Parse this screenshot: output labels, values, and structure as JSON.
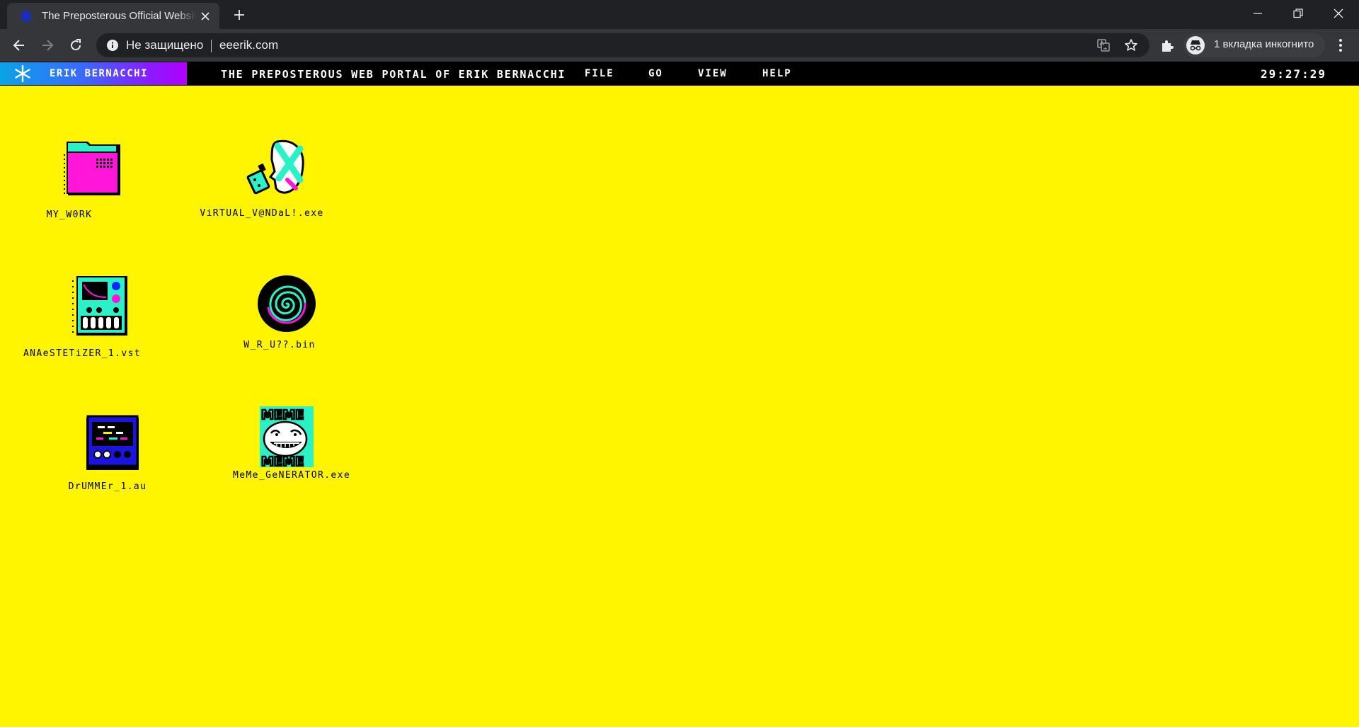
{
  "browser": {
    "tab_title": "The Preposterous Official Website",
    "security_label": "Не защищено",
    "url": "eeerik.com",
    "incognito_label": "1 вкладка инкогнито",
    "accent": "#0a28ff"
  },
  "site": {
    "brand_name": "ERIK BERNACCHI",
    "portal_title": "THE PREPOSTEROUS WEB PORTAL OF ERIK BERNACCHI",
    "menu": [
      "FILE",
      "GO",
      "VIEW",
      "HELP"
    ],
    "clock": "29:27:29",
    "background": "#fff500"
  },
  "desktop": {
    "icons": [
      {
        "label": "MY_W0RK",
        "icon": "folder-icon"
      },
      {
        "label": "ViRTUAL_V@NDaL!.exe",
        "icon": "spray-head-icon"
      },
      {
        "label": "ANAeSTETiZER_1.vst",
        "icon": "synth-plugin-icon"
      },
      {
        "label": "W_R_U??.bin",
        "icon": "spiral-icon"
      },
      {
        "label": "DrUMMEr_1.au",
        "icon": "drum-machine-icon"
      },
      {
        "label": "MeMe_GeNERATOR.exe",
        "icon": "troll-face-icon"
      }
    ]
  }
}
